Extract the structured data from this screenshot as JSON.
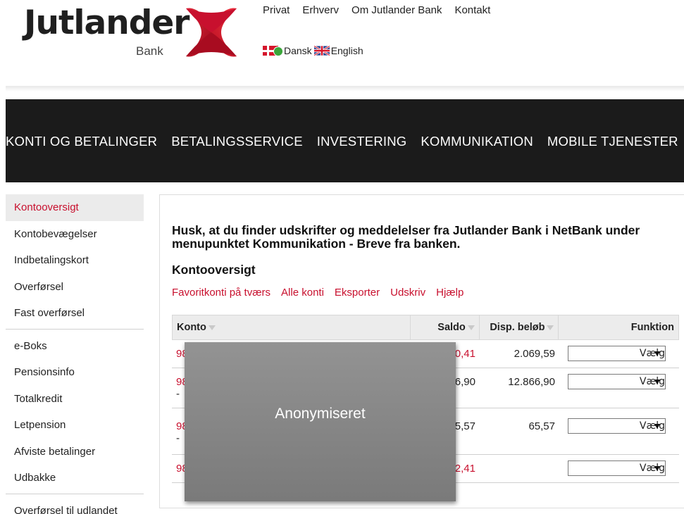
{
  "brand": {
    "name": "Jutlander",
    "sub": "Bank",
    "logo_icon": "jutlander-x-logo"
  },
  "top_nav": [
    "Privat",
    "Erhverv",
    "Om Jutlander Bank",
    "Kontakt"
  ],
  "languages": [
    {
      "label": "Dansk",
      "icon": "flag-dk-icon",
      "selected": true
    },
    {
      "label": "English",
      "icon": "flag-uk-icon",
      "selected": false
    }
  ],
  "main_nav": [
    "KONTI OG BETALINGER",
    "BETALINGSSERVICE",
    "INVESTERING",
    "KOMMUNIKATION",
    "MOBILE TJENESTER"
  ],
  "sidebar": {
    "group1": [
      "Kontooversigt",
      "Kontobevægelser",
      "Indbetalingskort",
      "Overførsel",
      "Fast overførsel"
    ],
    "group2": [
      "e-Boks",
      "Pensionsinfo",
      "Totalkredit",
      "Letpension",
      "Afviste betalinger",
      "Udbakke"
    ],
    "group3": [
      "Overførsel til udlandet"
    ],
    "active": "Kontooversigt"
  },
  "content": {
    "notice": "Husk, at du finder udskrifter og meddelelser fra Jutlander Bank i NetBank under menupunktet Kommunikation - Breve fra banken.",
    "heading": "Kontooversigt",
    "actions": [
      "Favoritkonti på tværs",
      "Alle konti",
      "Eksporter",
      "Udskriv",
      "Hjælp"
    ],
    "table": {
      "headers": {
        "konto": "Konto",
        "saldo": "Saldo",
        "disp": "Disp. beløb",
        "func": "Funktion"
      },
      "rows": [
        {
          "konto": "98",
          "saldo": "0,41",
          "disp": "2.069,59",
          "func": "Vælg"
        },
        {
          "konto": "98",
          "konto_sub": "-",
          "saldo": "6,90",
          "disp": "12.866,90",
          "func": "Vælg"
        },
        {
          "konto": "98",
          "konto_sub": "-",
          "saldo": "5,57",
          "disp": "65,57",
          "func": "Vælg"
        },
        {
          "konto": "98",
          "saldo": "2,41",
          "disp": "",
          "func": "Vælg"
        }
      ]
    }
  },
  "overlay": {
    "text": "Anonymiseret"
  },
  "colors": {
    "accent": "#c8102e",
    "nav_bg": "#1b1b1b",
    "logo_red": "#d5162c"
  }
}
